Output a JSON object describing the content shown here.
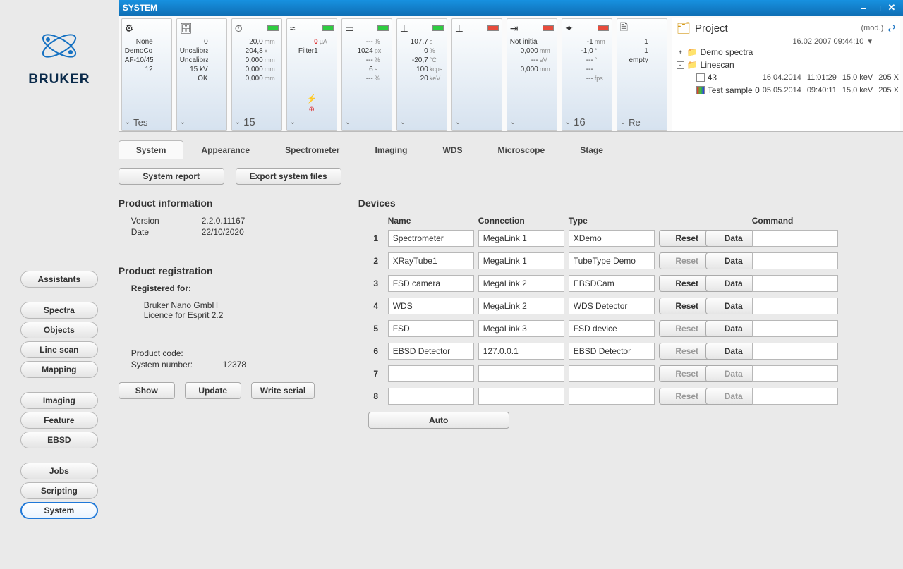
{
  "titlebar": {
    "text": "SYSTEM"
  },
  "cards": [
    {
      "foot": "Tes",
      "rows": [
        {
          "v": "None",
          "u": ""
        },
        {
          "v": "DemoCo Ltd",
          "u": ""
        },
        {
          "v": "AF-10/45",
          "u": ""
        },
        {
          "v": "12",
          "u": ""
        }
      ],
      "status": ""
    },
    {
      "foot": "",
      "rows": [
        {
          "v": "0",
          "u": ""
        },
        {
          "v": "Uncalibrate",
          "u": ""
        },
        {
          "v": "Uncalibrate",
          "u": ""
        },
        {
          "v": "15 kV",
          "u": ""
        },
        {
          "v": "OK",
          "u": ""
        }
      ],
      "status": ""
    },
    {
      "foot": "15",
      "rows": [
        {
          "v": "20,0",
          "u": "mm"
        },
        {
          "v": "204,8",
          "u": "x"
        },
        {
          "v": "0,000",
          "u": "mm"
        },
        {
          "v": "0,000",
          "u": "mm"
        },
        {
          "v": "0,000",
          "u": "mm"
        }
      ],
      "status": "green"
    },
    {
      "foot": "",
      "rows": [
        {
          "v": "0",
          "u": "µA",
          "red": true
        },
        {
          "v": "Filter1",
          "u": ""
        }
      ],
      "status": "green",
      "hv_icon": true
    },
    {
      "foot": "",
      "rows": [
        {
          "v": "---",
          "u": "%"
        },
        {
          "v": "1024",
          "u": "px"
        },
        {
          "v": "---",
          "u": "%"
        },
        {
          "v": "6",
          "u": "s"
        },
        {
          "v": "---",
          "u": "%"
        }
      ],
      "status": "green"
    },
    {
      "foot": "",
      "rows": [
        {
          "v": "107,7",
          "u": "s"
        },
        {
          "v": "0",
          "u": "%"
        },
        {
          "v": "-20,7",
          "u": "°C"
        },
        {
          "v": "100",
          "u": "kcps"
        },
        {
          "v": "20",
          "u": "keV"
        }
      ],
      "status": "green"
    },
    {
      "foot": "",
      "rows": [],
      "status": "red"
    },
    {
      "foot": "",
      "rows": [
        {
          "v": "Not initialize",
          "u": ""
        },
        {
          "v": "",
          "u": ""
        },
        {
          "v": "0,000",
          "u": "mm"
        },
        {
          "v": "---",
          "u": "eV"
        },
        {
          "v": "0,000",
          "u": "mm"
        }
      ],
      "status": "red"
    },
    {
      "foot": "16",
      "rows": [
        {
          "v": "-1",
          "u": "mm"
        },
        {
          "v": "-1,0",
          "u": "°"
        },
        {
          "v": "---",
          "u": "°"
        },
        {
          "v": "---",
          "u": ""
        },
        {
          "v": "---",
          "u": "fps"
        }
      ],
      "status": "red"
    },
    {
      "foot": "Re",
      "rows": [
        {
          "v": "1",
          "u": ""
        },
        {
          "v": "1",
          "u": ""
        },
        {
          "v": "empty",
          "u": ""
        }
      ],
      "status": ""
    }
  ],
  "project": {
    "title": "Project",
    "mod": "(mod.)",
    "date": "16.02.2007 09:44:10",
    "tree": [
      {
        "type": "folder",
        "label": "Demo spectra",
        "expand": "+"
      },
      {
        "type": "folder",
        "label": "Linescan",
        "expand": "-"
      },
      {
        "type": "item",
        "indent": 1,
        "icon": "bw",
        "label": "43",
        "d1": "16.04.2014",
        "d2": "11:01:29",
        "d3": "15,0 keV",
        "d4": "205 X"
      },
      {
        "type": "item",
        "indent": 1,
        "icon": "color",
        "label": "Test sample 0",
        "d1": "05.05.2014",
        "d2": "09:40:11",
        "d3": "15,0 keV",
        "d4": "205 X"
      }
    ]
  },
  "nav": [
    "Assistants",
    "Spectra",
    "Objects",
    "Line scan",
    "Mapping",
    "Imaging",
    "Feature",
    "EBSD",
    "Jobs",
    "Scripting",
    "System"
  ],
  "nav_active": "System",
  "tabs": [
    "System",
    "Appearance",
    "Spectrometer",
    "Imaging",
    "WDS",
    "Microscope",
    "Stage"
  ],
  "tab_active": "System",
  "actions": {
    "report": "System report",
    "export": "Export system files"
  },
  "product_info": {
    "heading": "Product information",
    "version_k": "Version",
    "version_v": "2.2.0.11167",
    "date_k": "Date",
    "date_v": "22/10/2020"
  },
  "registration": {
    "heading": "Product registration",
    "reg_for": "Registered for:",
    "line1": "Bruker Nano GmbH",
    "line2": "Licence for Esprit 2.2",
    "code_k": "Product code:",
    "sysnum_k": "System number:",
    "sysnum_v": "12378",
    "show": "Show",
    "update": "Update",
    "writeserial": "Write serial"
  },
  "devices": {
    "heading": "Devices",
    "headers": {
      "name": "Name",
      "conn": "Connection",
      "type": "Type",
      "cmd": "Command"
    },
    "reset": "Reset",
    "data": "Data",
    "auto": "Auto",
    "rows": [
      {
        "n": "1",
        "name": "Spectrometer",
        "conn": "MegaLink 1",
        "type": "XDemo",
        "reset": true,
        "data": true
      },
      {
        "n": "2",
        "name": "XRayTube1",
        "conn": "MegaLink 1",
        "type": "TubeType Demo",
        "reset": false,
        "data": true
      },
      {
        "n": "3",
        "name": "FSD camera",
        "conn": "MegaLink 2",
        "type": "EBSDCam",
        "reset": true,
        "data": true
      },
      {
        "n": "4",
        "name": "WDS",
        "conn": "MegaLink 2",
        "type": "WDS Detector",
        "reset": true,
        "data": true
      },
      {
        "n": "5",
        "name": "FSD",
        "conn": "MegaLink 3",
        "type": "FSD device",
        "reset": false,
        "data": true
      },
      {
        "n": "6",
        "name": "EBSD Detector",
        "conn": "127.0.0.1",
        "type": "EBSD Detector",
        "reset": false,
        "data": true
      },
      {
        "n": "7",
        "name": "",
        "conn": "",
        "type": "",
        "reset": false,
        "data": false
      },
      {
        "n": "8",
        "name": "",
        "conn": "",
        "type": "",
        "reset": false,
        "data": false
      }
    ]
  }
}
